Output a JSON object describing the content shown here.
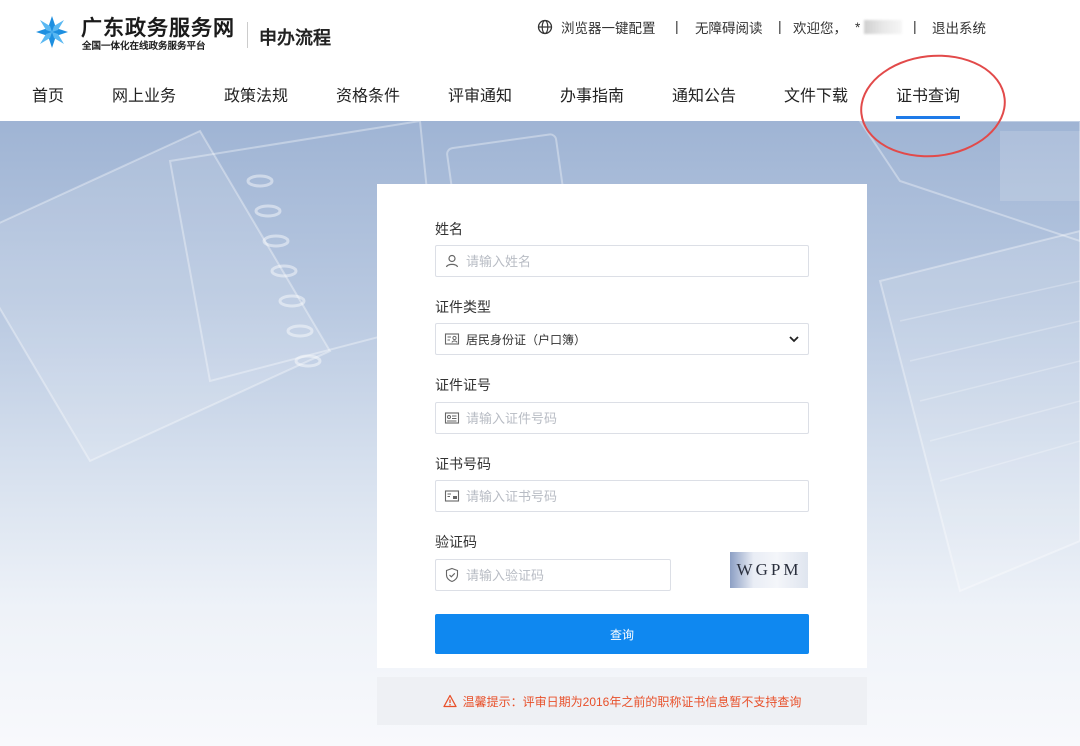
{
  "header": {
    "brand_title": "广东政务服务网",
    "brand_subtitle": "全国一体化在线政务服务平台",
    "section_title": "申办流程",
    "browser_config": "浏览器一键配置",
    "accessibility": "无障碍阅读",
    "welcome": "欢迎您，",
    "user_masked": "*",
    "logout": "退出系统",
    "separator": "|"
  },
  "nav": {
    "items": [
      "首页",
      "网上业务",
      "政策法规",
      "资格条件",
      "评审通知",
      "办事指南",
      "通知公告",
      "文件下载",
      "证书查询"
    ],
    "active": "证书查询"
  },
  "form": {
    "name_label": "姓名",
    "name_placeholder": "请输入姓名",
    "id_type_label": "证件类型",
    "id_type_value": "居民身份证（户口簿）",
    "id_number_label": "证件证号",
    "id_number_placeholder": "请输入证件号码",
    "cert_number_label": "证书号码",
    "cert_number_placeholder": "请输入证书号码",
    "captcha_label": "验证码",
    "captcha_placeholder": "请输入验证码",
    "captcha_text": "WGPM",
    "submit_label": "查询"
  },
  "notice": {
    "text": "温馨提示：评审日期为2016年之前的职称证书信息暂不支持查询"
  },
  "colors": {
    "accent": "#0f88f0",
    "nav_active": "#1e7ae8",
    "warning": "#e8502a",
    "highlight_circle": "#e24a4a"
  }
}
